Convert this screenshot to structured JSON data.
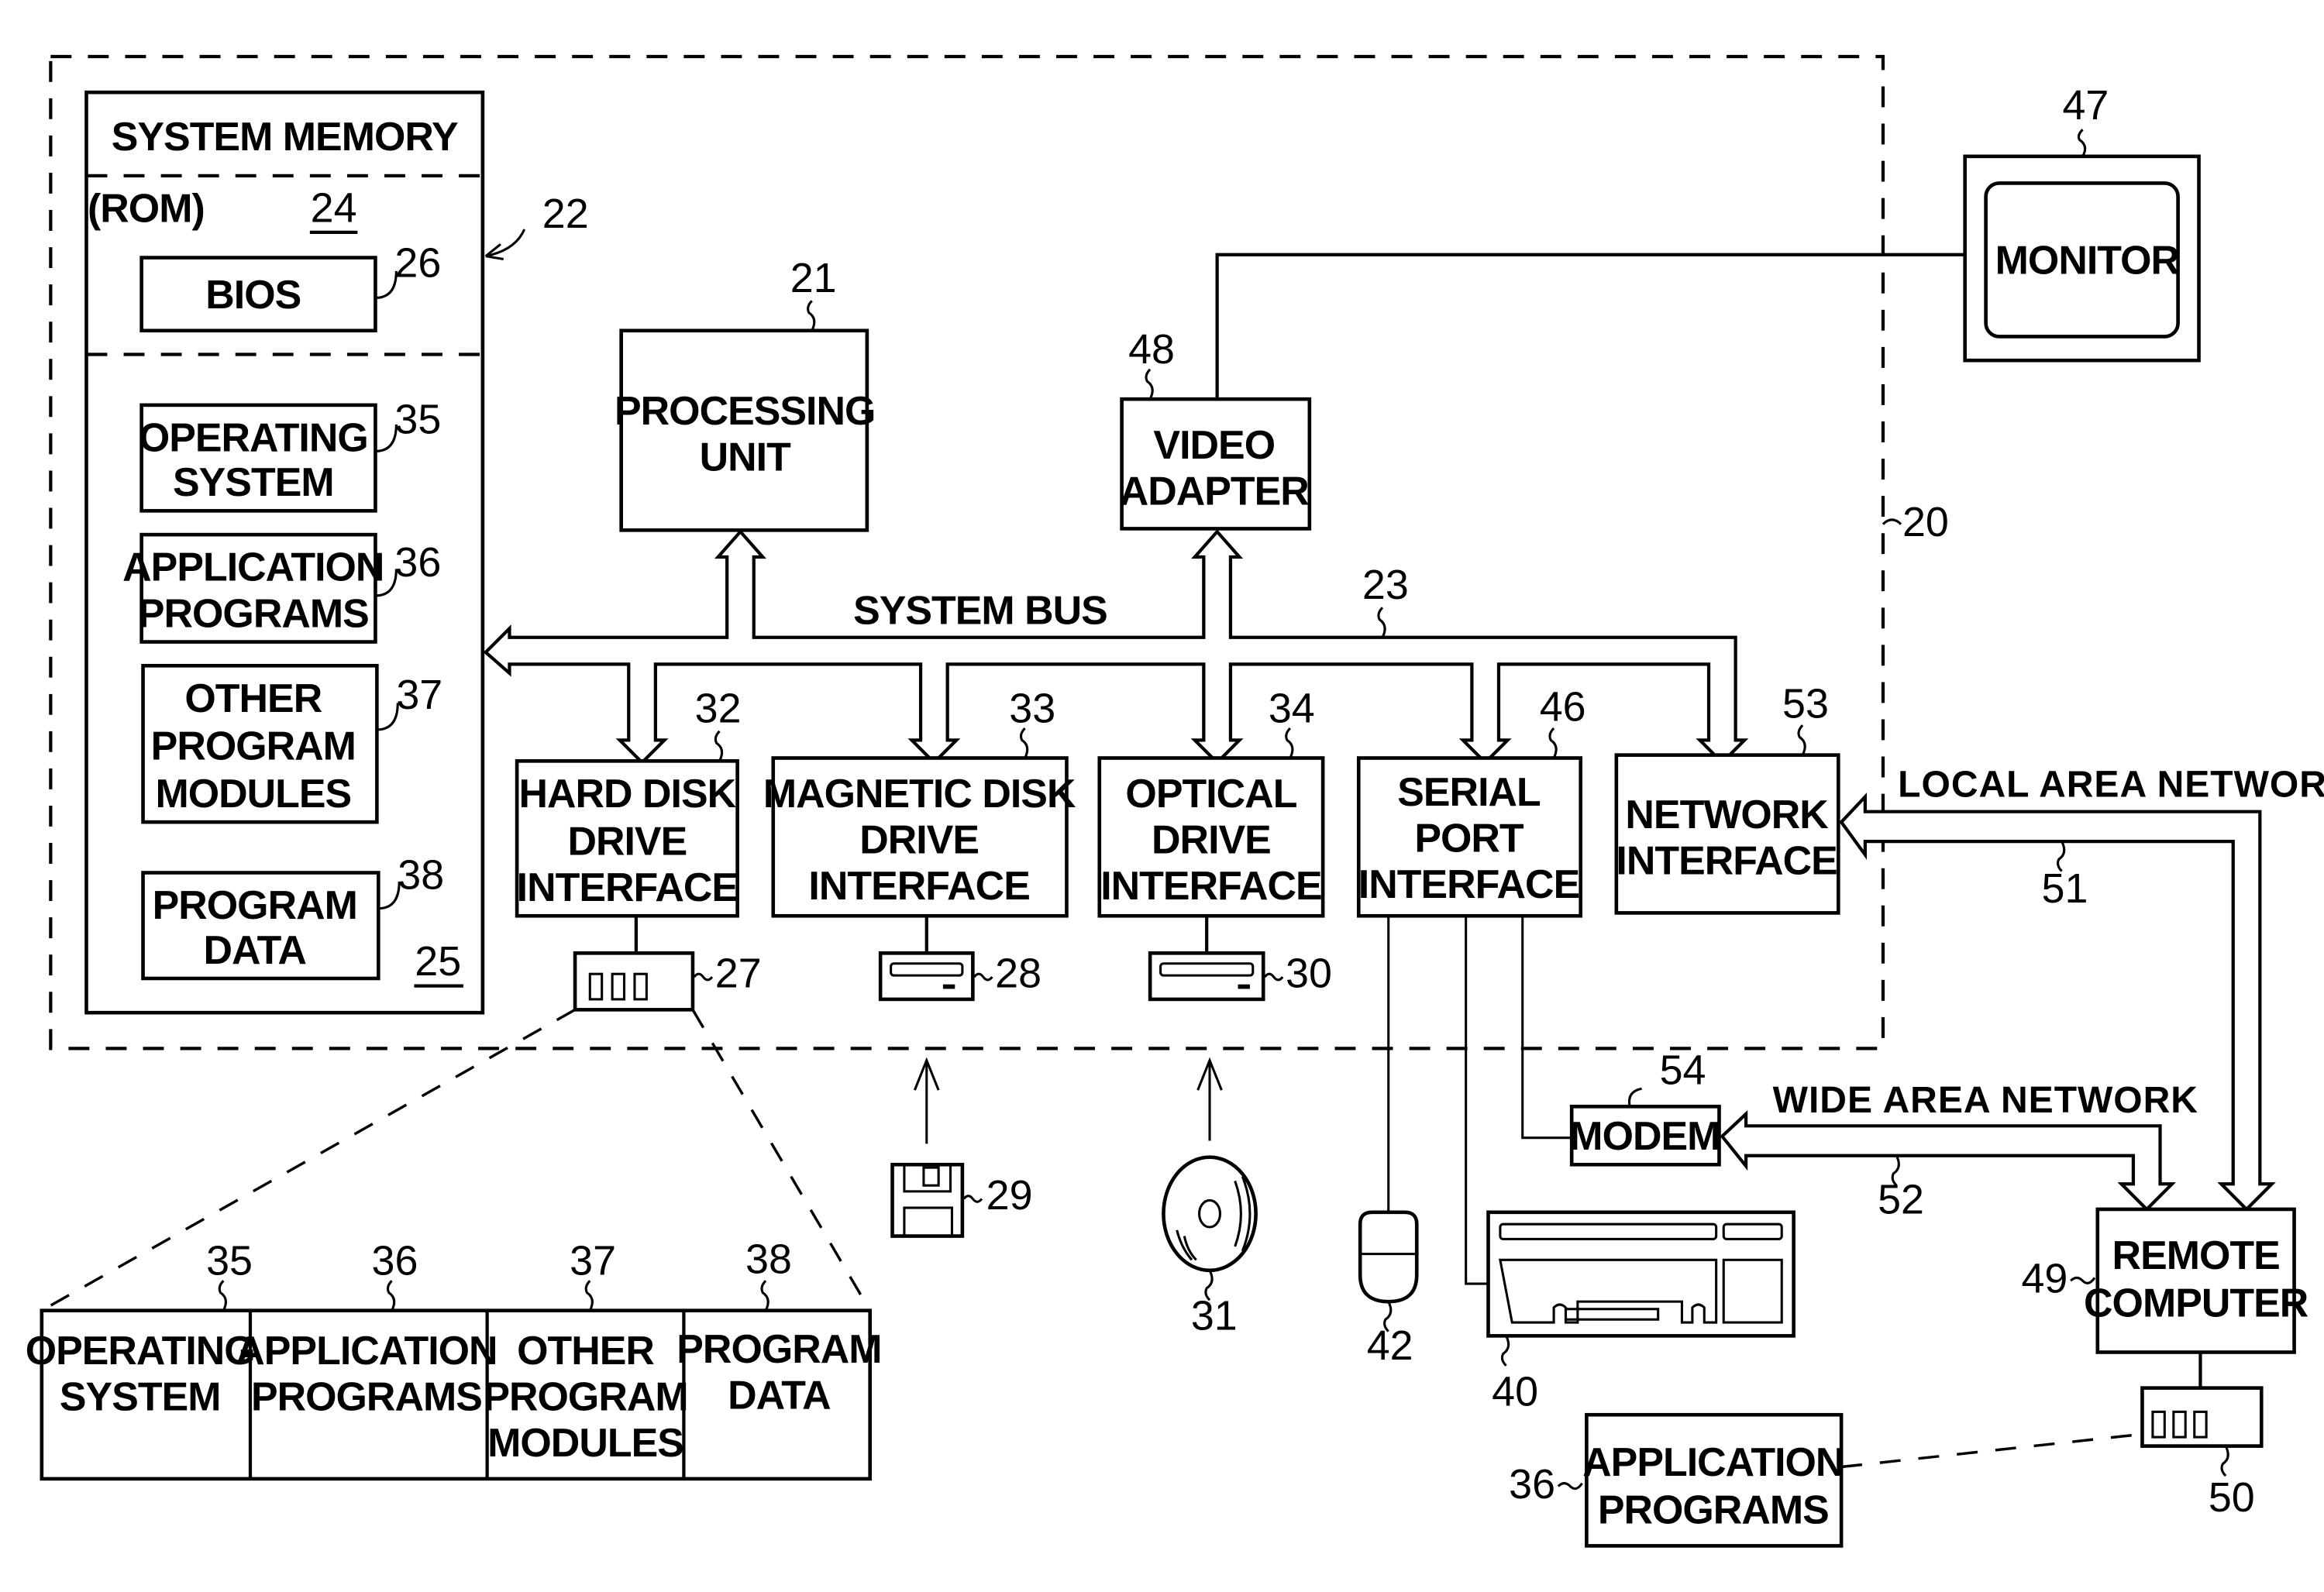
{
  "figure": {
    "computer_ref": "20",
    "system_memory": {
      "title": "SYSTEM MEMORY",
      "ref": "22",
      "rom_label": "(ROM)",
      "rom_ref": "24",
      "ram_ref": "25",
      "bios": {
        "label": "BIOS",
        "ref": "26"
      },
      "items": [
        {
          "lines": [
            "OPERATING",
            "SYSTEM"
          ],
          "ref": "35"
        },
        {
          "lines": [
            "APPLICATION",
            "PROGRAMS"
          ],
          "ref": "36"
        },
        {
          "lines": [
            "OTHER",
            "PROGRAM",
            "MODULES"
          ],
          "ref": "37"
        },
        {
          "lines": [
            "PROGRAM",
            "DATA"
          ],
          "ref": "38"
        }
      ]
    },
    "processing_unit": {
      "lines": [
        "PROCESSING",
        "UNIT"
      ],
      "ref": "21"
    },
    "video_adapter": {
      "lines": [
        "VIDEO",
        "ADAPTER"
      ],
      "ref": "48"
    },
    "monitor": {
      "label": "MONITOR",
      "ref": "47"
    },
    "system_bus": {
      "label": "SYSTEM BUS",
      "ref": "23"
    },
    "interfaces": [
      {
        "lines": [
          "HARD  DISK",
          "DRIVE",
          "INTERFACE"
        ],
        "ref": "32"
      },
      {
        "lines": [
          "MAGNETIC  DISK",
          "DRIVE",
          "INTERFACE"
        ],
        "ref": "33"
      },
      {
        "lines": [
          "OPTICAL",
          "DRIVE",
          "INTERFACE"
        ],
        "ref": "34"
      },
      {
        "lines": [
          "SERIAL",
          "PORT",
          "INTERFACE"
        ],
        "ref": "46"
      },
      {
        "lines": [
          "NETWORK",
          "INTERFACE"
        ],
        "ref": "53"
      }
    ],
    "devices": {
      "hard_disk": "27",
      "magnetic_drive": "28",
      "optical_drive": "30",
      "floppy_disk": "29",
      "optical_disc": "31",
      "mouse": "42",
      "keyboard": "40",
      "modem": {
        "label": "MODEM",
        "ref": "54"
      }
    },
    "networks": {
      "lan": {
        "label": "LOCAL  AREA  NETWORK",
        "ref": "51"
      },
      "wan": {
        "label": "WIDE  AREA  NETWORK",
        "ref": "52"
      }
    },
    "remote_computer": {
      "lines": [
        "REMOTE",
        "COMPUTER"
      ],
      "ref": "49"
    },
    "remote_storage": {
      "ref": "50"
    },
    "remote_apps": {
      "lines": [
        "APPLICATION",
        "PROGRAMS"
      ],
      "ref": "36"
    },
    "hard_disk_contents": [
      {
        "lines": [
          "OPERATING",
          "SYSTEM"
        ],
        "ref": "35"
      },
      {
        "lines": [
          "APPLICATION",
          "PROGRAMS"
        ],
        "ref": "36"
      },
      {
        "lines": [
          "OTHER",
          "PROGRAM",
          "MODULES"
        ],
        "ref": "37"
      },
      {
        "lines": [
          "PROGRAM",
          "DATA"
        ],
        "ref": "38"
      }
    ]
  }
}
